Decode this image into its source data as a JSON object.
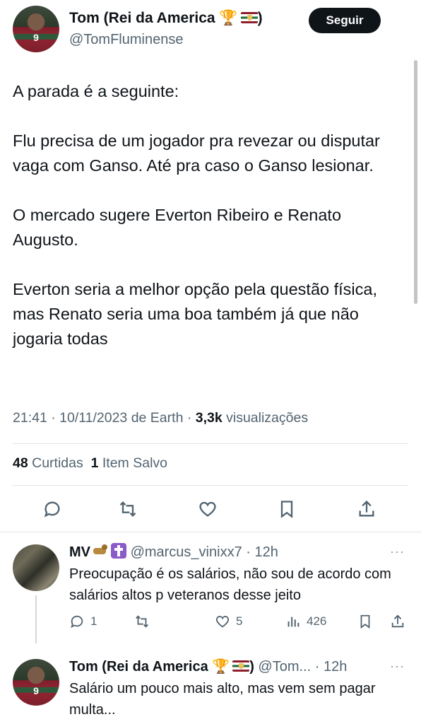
{
  "header": {
    "display_name": "Tom (Rei da America",
    "name_suffix": ")",
    "handle": "@TomFluminense",
    "follow_label": "Seguir",
    "avatar_number": "9"
  },
  "tweet": {
    "paragraphs": [
      "A parada é a seguinte:",
      "Flu precisa de um jogador pra revezar ou disputar vaga com Ganso. Até pra caso o Ganso lesionar.",
      "O mercado sugere Everton Ribeiro e Renato Augusto.",
      "Everton seria a melhor opção pela questão física, mas Renato seria uma boa também já que não jogaria todas"
    ],
    "timestamp": "21:41 · 10/11/2023 de Earth ·",
    "views_count": "3,3k",
    "views_label": "visualizações",
    "likes_count": "48",
    "likes_label": "Curtidas",
    "saves_count": "1",
    "saves_label": "Item Salvo"
  },
  "icons": {
    "reply": "reply-icon",
    "retweet": "retweet-icon",
    "like": "heart-icon",
    "bookmark": "bookmark-icon",
    "share": "share-icon",
    "views": "views-icon",
    "more": "more-icon"
  },
  "colors": {
    "text": "#0f1419",
    "secondary": "#536471",
    "follow_bg": "#0f1419",
    "divider": "#e1e5e8"
  },
  "replies": [
    {
      "display_name": "MV",
      "handle": "@marcus_vinixx7",
      "time": "· 12h",
      "text": "Preocupação é os salários, não sou de acordo com salários altos p veteranos desse jeito",
      "reply_count": "1",
      "like_count": "5",
      "view_count": "426",
      "more": "···"
    },
    {
      "display_name": "Tom (Rei da America",
      "name_suffix": ")",
      "handle": "@Tom...",
      "time": "· 12h",
      "text": "Salário um pouco mais alto, mas vem sem pagar multa...",
      "more": "···"
    }
  ]
}
